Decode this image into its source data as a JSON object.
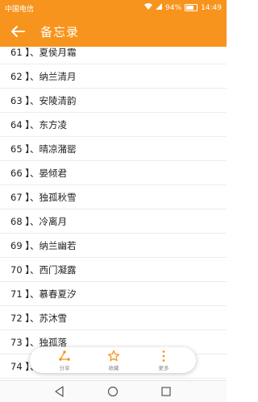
{
  "status_bar": {
    "carrier": "中国电信",
    "signal_text": "94%",
    "time": "14:49"
  },
  "app_bar": {
    "title": "备忘录",
    "back_icon": "arrow-left-icon"
  },
  "list": {
    "items": [
      "61 】、夏侯月霜",
      "62 】、纳兰清月",
      "63 】、安陵清韵",
      "64 】、东方凌",
      "65 】、晴凉潴罂",
      "66 】、晏倾君",
      "67 】、独孤秋雪",
      "68 】、冷离月",
      "69 】、纳兰幽若",
      "70 】、西门凝露",
      "71 】、慕春夏汐",
      "72 】、苏沐雪",
      "73 】、独孤落",
      "74 】、"
    ]
  },
  "toolbar": {
    "share_label": "分享",
    "favorite_label": "收藏",
    "more_label": "更多",
    "accent": "#f7941d"
  },
  "colors": {
    "primary": "#f7941d"
  }
}
